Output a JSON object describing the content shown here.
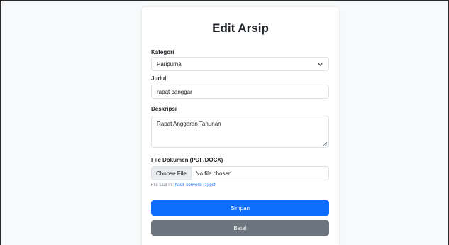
{
  "form": {
    "title": "Edit Arsip",
    "kategori": {
      "label": "Kategori",
      "value": "Paripurna"
    },
    "judul": {
      "label": "Judul",
      "value": "rapat banggar"
    },
    "deskripsi": {
      "label": "Deskripsi",
      "value": "Rapat Anggaran Tahunan"
    },
    "file": {
      "label": "File Dokumen (PDF/DOCX)",
      "button_label": "Choose File",
      "status": "No file chosen",
      "current_prefix": "File saat ini:",
      "current_link": "hasil_konversi (1).pdf"
    },
    "save_label": "Simpan",
    "cancel_label": "Batal"
  },
  "colors": {
    "primary": "#0d6efd",
    "secondary": "#6c757d",
    "background": "#f8f9fa"
  },
  "icons": {
    "select": "chevron-down-icon",
    "textarea": "resize-grip-icon"
  }
}
